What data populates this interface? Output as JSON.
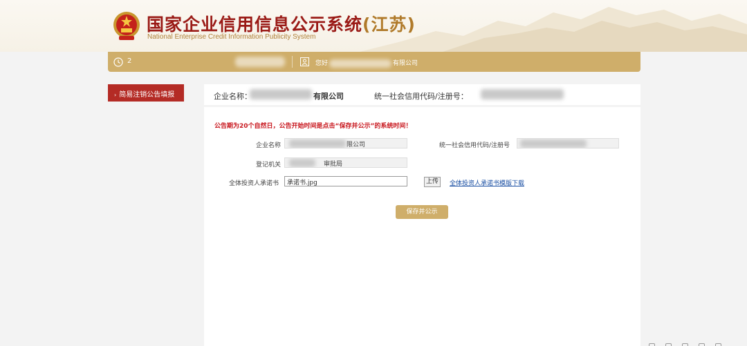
{
  "header": {
    "title_main": "国家企业信用信息公示系统",
    "title_region": "(江苏)",
    "subtitle": "National Enterprise Credit Information Publicity System"
  },
  "userbar": {
    "clock_text": "2",
    "greeting_prefix": "您好",
    "greeting_suffix": "有限公司"
  },
  "sidebar": {
    "items": [
      {
        "label": "简易注销公告填报"
      }
    ]
  },
  "summary": {
    "company_label": "企业名称：",
    "company_suffix": "有限公司",
    "code_label": "统一社会信用代码/注册号："
  },
  "form": {
    "notice": "公告期为20个自然日，公告开始时间是点击“保存并公示”的系统时间！",
    "company_label": "企业名称",
    "company_value_suffix": "限公司",
    "code_label": "统一社会信用代码/注册号",
    "authority_label": "登记机关",
    "authority_value_suffix": "审批局",
    "commitment_label": "全体投资人承诺书",
    "commitment_value": "承诺书.jpg",
    "upload_label": "上传",
    "template_link": "全体投资人承诺书模版下载",
    "save_label": "保存并公示"
  },
  "colors": {
    "brand_red": "#b42b25",
    "gold": "#cfae6a",
    "notice_red": "#c8161d",
    "link_blue": "#1a4fa3"
  }
}
